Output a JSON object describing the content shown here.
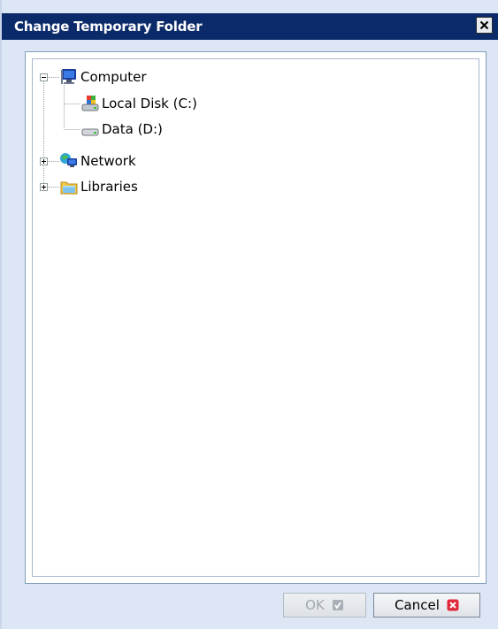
{
  "window": {
    "title": "Change Temporary Folder",
    "close_label": "Close"
  },
  "tree": {
    "computer": {
      "label": "Computer",
      "expanded": true,
      "children": [
        {
          "label": "Local Disk (C:)",
          "icon": "local-disk-icon"
        },
        {
          "label": "Data (D:)",
          "icon": "drive-icon"
        }
      ]
    },
    "network": {
      "label": "Network",
      "expanded": false
    },
    "libraries": {
      "label": "Libraries",
      "expanded": false
    }
  },
  "buttons": {
    "ok_label": "OK",
    "ok_enabled": false,
    "cancel_label": "Cancel"
  },
  "colors": {
    "titlebar": "#0b2a6a",
    "dialog_bg": "#dce6f4",
    "cancel_icon": "#e0283a"
  }
}
